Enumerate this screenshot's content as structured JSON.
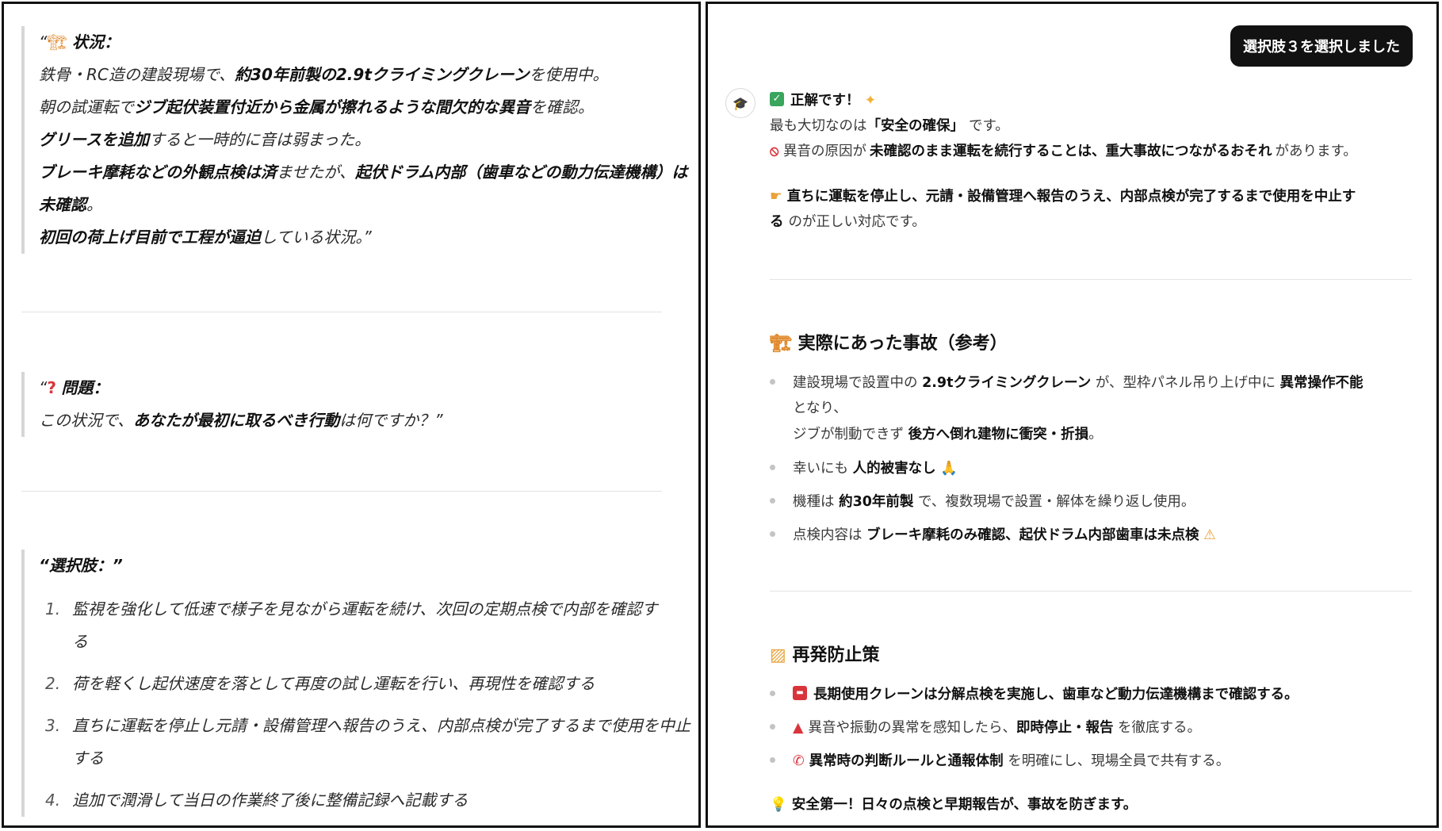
{
  "left": {
    "situation": {
      "label": "状況：",
      "lines": [
        [
          "鉄骨・RC造の建設現場で、",
          "約30年前製の2.9tクライミングクレーン",
          "を使用中。"
        ],
        [
          "朝の試運転で",
          "ジブ起伏装置付近から金属が擦れるような間欠的な異音",
          "を確認。"
        ],
        [
          "",
          "グリースを追加",
          "すると一時的に音は弱まった。"
        ],
        [
          "",
          "ブレーキ摩耗などの外観点検は済",
          "ませたが、",
          "起伏ドラム内部（歯車などの動力伝達機構）は"
        ],
        [
          "",
          "未確認",
          "。"
        ],
        [
          "",
          "初回の荷上げ目前で工程が逼迫",
          "している状況。”"
        ]
      ]
    },
    "question": {
      "label": "問題：",
      "line": [
        "この状況で、",
        "あなたが最初に取るべき行動",
        "は何ですか？”"
      ]
    },
    "choices": {
      "label": "“選択肢：”",
      "items": [
        {
          "num": "1.",
          "text": "監視を強化して低速で様子を見ながら運転を続け、次回の定期点検で内部を確認する"
        },
        {
          "num": "2.",
          "text": "荷を軽くし起伏速度を落として再度の試し運転を行い、再現性を確認する"
        },
        {
          "num": "3.",
          "text": "直ちに運転を停止し元請・設備管理へ報告のうえ、内部点検が完了するまで使用を中止",
          "text2": "する"
        },
        {
          "num": "4.",
          "text": "追加で潤滑して当日の作業終了後に整備記録へ記載する"
        }
      ]
    }
  },
  "right": {
    "toast": "選択肢３を選択しました",
    "correct_label": "正解です！",
    "most_important": [
      "最も大切なのは",
      "「安全の確保」",
      "です。"
    ],
    "warning": [
      "異音の原因が",
      "未確認のまま運転を続行することは、重大事故につながるおそれ",
      "があります。"
    ],
    "action_1": "直ちに運転を停止し、元請・設備管理へ報告のうえ、内部点検が完了するまで使用を中止す",
    "action_2": [
      "る",
      "のが正しい対応です。"
    ],
    "accident_heading": "実際にあった事故（参考）",
    "accidents": [
      [
        "建設現場で設置中の",
        "2.9tクライミングクレーン",
        "が、型枠パネル吊り上げ中に",
        "異常操作不能"
      ],
      [
        "となり、"
      ],
      [
        "ジブが制動できず",
        "後方へ倒れ建物に衝突・折損",
        "。"
      ],
      [
        "幸いにも",
        "人的被害なし"
      ],
      [
        "機種は",
        "約30年前製",
        "で、複数現場で設置・解体を繰り返し使用。"
      ],
      [
        "点検内容は",
        "ブレーキ摩耗のみ確認、起伏ドラム内部歯車は未点検"
      ]
    ],
    "prevention_heading": "再発防止策",
    "preventions": [
      [
        "",
        "長期使用クレーンは分解点検を実施し、歯車など動力伝達機構まで確認する。",
        ""
      ],
      [
        "異音や振動の異常を感知したら、",
        "即時停止・報告",
        "を徹底する。"
      ],
      [
        "",
        "異常時の判断ルールと通報体制",
        "を明確にし、現場全員で共有する。"
      ]
    ],
    "footer": "安全第一！日々の点検と早期報告が、事故を防ぎます。"
  },
  "icons": {
    "crane": "crane-icon",
    "question": "question-mark-icon",
    "check": "check-icon",
    "sparkle": "sparkle-icon",
    "prohibited": "prohibited-icon",
    "pointing": "pointing-hand-icon",
    "pray": "praying-hands-icon",
    "warning": "warning-icon",
    "barrier": "construction-barrier-icon",
    "toolbox": "toolbox-icon",
    "siren": "siren-icon",
    "phone": "phone-icon",
    "bulb": "lightbulb-icon",
    "grad": "graduation-cap-icon"
  },
  "colors": {
    "check_green": "#3aa55c",
    "prohibited_red": "#d9343b",
    "toast_bg": "#121212"
  }
}
